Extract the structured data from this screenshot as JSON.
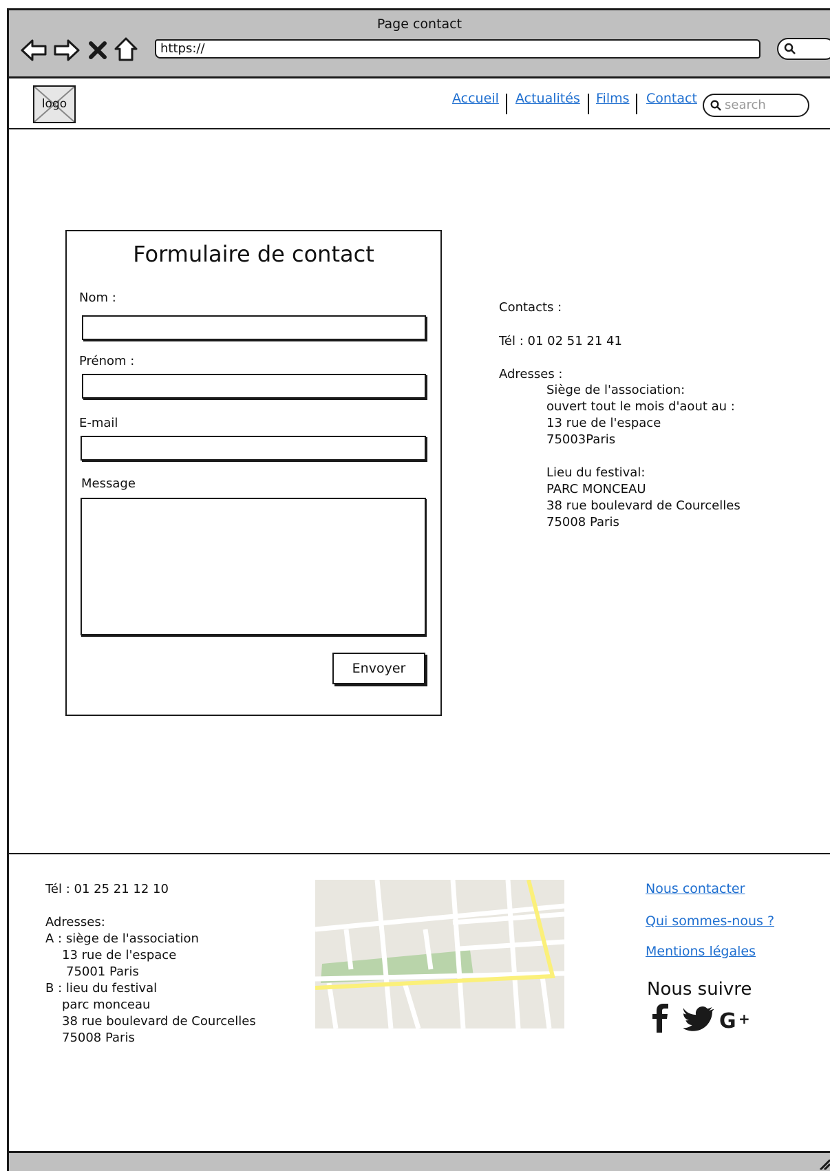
{
  "browser": {
    "window_title": "Page contact",
    "url": "https://"
  },
  "header": {
    "logo_text": "logo",
    "nav": [
      "Accueil",
      "Actualités",
      "Films",
      "Contact"
    ],
    "search_placeholder": "search",
    "link_color": "#1f6fd0"
  },
  "form": {
    "title": "Formulaire de contact",
    "nom_label": "Nom :",
    "prenom_label": "Prénom :",
    "email_label": "E-mail",
    "message_label": "Message",
    "submit_label": "Envoyer"
  },
  "contacts": {
    "heading": "Contacts :",
    "tel": "Tél : 01 02 51 21 41",
    "addresses_label": "Adresses :",
    "siege_lines": [
      "Siège de l'association:",
      "ouvert tout le mois d'aout au :",
      "13 rue de l'espace",
      "75003Paris"
    ],
    "festival_lines": [
      "Lieu du festival:",
      "PARC MONCEAU",
      "38 rue boulevard de Courcelles",
      "75008 Paris"
    ]
  },
  "footer": {
    "tel": "Tél : 01 25 21 12 10",
    "addresses_label": "Adresses:",
    "address_lines": [
      "A : siège de l'association",
      "13 rue de l'espace",
      "75001 Paris",
      "B : lieu du festival",
      "parc monceau",
      "38 rue boulevard de Courcelles",
      "75008 Paris"
    ],
    "links": [
      "Nous contacter",
      "Qui sommes-nous ?",
      "Mentions légales"
    ],
    "follow_label": "Nous suivre",
    "social_icons": [
      "facebook-icon",
      "twitter-icon",
      "google-plus-icon"
    ]
  }
}
